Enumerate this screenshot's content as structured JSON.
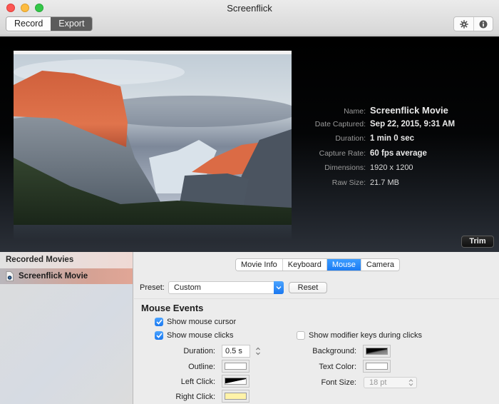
{
  "window": {
    "title": "Screenflick",
    "mode_tabs": [
      {
        "label": "Record",
        "active": false
      },
      {
        "label": "Export",
        "active": true
      }
    ],
    "toolbar_icons": [
      "gear-icon",
      "info-icon"
    ]
  },
  "preview": {
    "thumbnail": "macOS El Capitan desktop wallpaper (Yosemite valley at sunset)",
    "info": [
      {
        "label": "Name:",
        "value": "Screenflick Movie"
      },
      {
        "label": "Date Captured:",
        "value": "Sep 22, 2015, 9:31 AM"
      },
      {
        "label": "Duration:",
        "value": "1 min 0 sec"
      },
      {
        "label": "Capture Rate:",
        "value": "60 fps average"
      },
      {
        "label": "Dimensions:",
        "value": "1920 x 1200"
      },
      {
        "label": "Raw Size:",
        "value": "21.7 MB"
      }
    ],
    "trim_label": "Trim"
  },
  "sidebar": {
    "header": "Recorded Movies",
    "items": [
      {
        "label": "Screenflick Movie",
        "selected": true
      }
    ]
  },
  "settings": {
    "tabs": [
      {
        "label": "Movie Info",
        "active": false
      },
      {
        "label": "Keyboard",
        "active": false
      },
      {
        "label": "Mouse",
        "active": true
      },
      {
        "label": "Camera",
        "active": false
      }
    ],
    "preset_label": "Preset:",
    "preset_value": "Custom",
    "reset_label": "Reset",
    "section_title": "Mouse Events",
    "show_cursor": {
      "label": "Show mouse cursor",
      "checked": true
    },
    "show_clicks": {
      "label": "Show mouse clicks",
      "checked": true
    },
    "show_modifiers": {
      "label": "Show modifier keys during clicks",
      "checked": false
    },
    "duration": {
      "label": "Duration:",
      "value": "0.5 s"
    },
    "outline": {
      "label": "Outline:",
      "color": "#ffffff"
    },
    "left_click": {
      "label": "Left Click:",
      "color": "#000000"
    },
    "right_click": {
      "label": "Right Click:",
      "color": "#fff3a8"
    },
    "background": {
      "label": "Background:",
      "color": "#000000"
    },
    "text_color": {
      "label": "Text Color:",
      "color": "#ffffff"
    },
    "font_size": {
      "label": "Font Size:",
      "value": "18 pt"
    }
  },
  "colors": {
    "accent": "#1b7cf4",
    "selection": "#e1a696"
  }
}
